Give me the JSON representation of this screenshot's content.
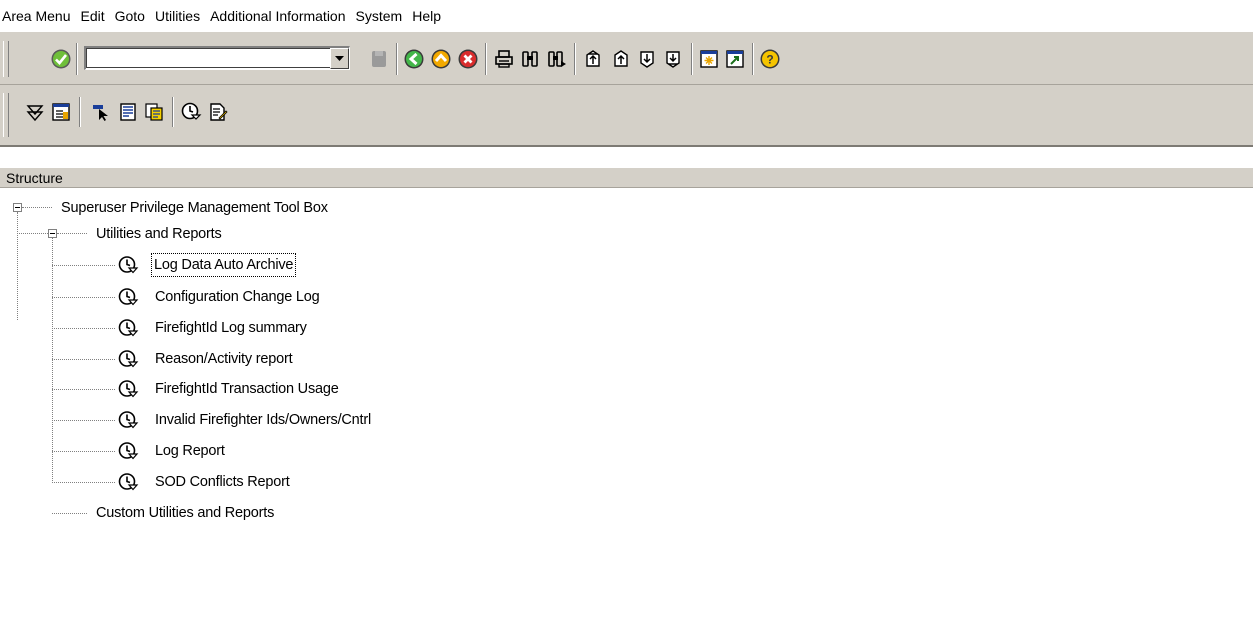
{
  "menubar": {
    "items": [
      "Area Menu",
      "Edit",
      "Goto",
      "Utilities",
      "Additional Information",
      "System",
      "Help"
    ]
  },
  "toolbar": {
    "command_field_value": "",
    "icons": [
      "enter-icon",
      "save-icon",
      "back-icon",
      "exit-icon",
      "cancel-icon",
      "print-icon",
      "find-icon",
      "find-next-icon",
      "first-page-icon",
      "previous-page-icon",
      "next-page-icon",
      "last-page-icon",
      "create-session-icon",
      "create-shortcut-icon",
      "help-icon"
    ]
  },
  "app_toolbar": {
    "icons": [
      "expand-subtree-icon",
      "collapse-icon",
      "select-icon",
      "display-icon",
      "copy-icon",
      "execute-icon",
      "documentation-icon"
    ]
  },
  "structure": {
    "header": "Structure",
    "root": {
      "label": "Superuser Privilege Management Tool Box",
      "children": [
        {
          "label": "Utilities and Reports",
          "items": [
            "Log Data Auto Archive",
            "Configuration Change Log",
            "FirefightId Log summary",
            "Reason/Activity report",
            "FirefightId Transaction Usage",
            "Invalid Firefighter Ids/Owners/Cntrl",
            "Log Report",
            "SOD Conflicts Report"
          ]
        },
        {
          "label": "Custom Utilities and Reports"
        }
      ]
    },
    "focused_item": "Log Data Auto Archive"
  },
  "colors": {
    "toolbar_bg": "#d4d0c8",
    "enter_green": "#2f8f2f",
    "nav_green": "#1b8a2a",
    "nav_yellow": "#e0a000",
    "cancel_red": "#c8102e",
    "help_yellow": "#f3c200"
  }
}
